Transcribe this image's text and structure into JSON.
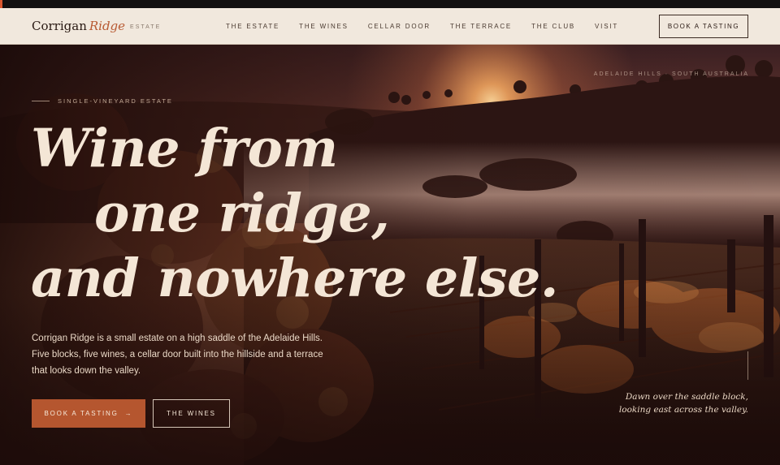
{
  "brand": {
    "name_primary": "Corrigan",
    "name_accent": "Ridge",
    "name_suffix": "ESTATE"
  },
  "nav": {
    "links": [
      "THE ESTATE",
      "THE WINES",
      "CELLAR DOOR",
      "THE TERRACE",
      "THE CLUB",
      "VISIT"
    ],
    "cta_label": "BOOK A TASTING"
  },
  "hero": {
    "location": "ADELAIDE HILLS · SOUTH AUSTRALIA",
    "eyebrow": "SINGLE-VINEYARD ESTATE",
    "headline": [
      "Wine from",
      "one ridge,",
      "and nowhere else."
    ],
    "description": "Corrigan Ridge is a small estate on a high saddle of the Adelaide Hills. Five blocks, five wines, a cellar door built into the hillside and a terrace that looks down the valley.",
    "primary_cta": "BOOK A TASTING",
    "primary_cta_arrow": "→",
    "secondary_cta": "THE WINES",
    "caption": [
      "Dawn over the saddle block,",
      "looking east across the valley."
    ]
  },
  "colors": {
    "accent": "#b5562f",
    "nav_bg": "#f1e8dd",
    "headline": "#f4e6d6"
  }
}
